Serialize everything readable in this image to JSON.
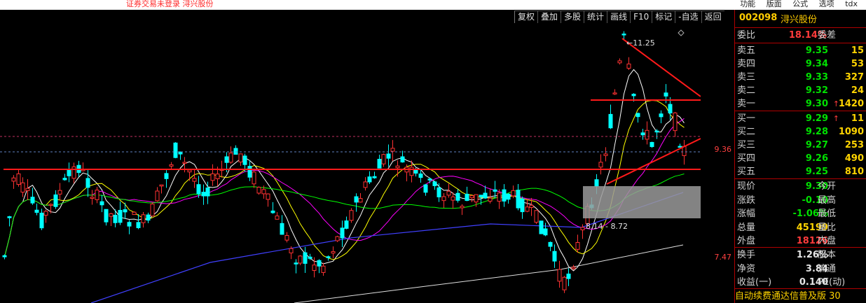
{
  "topbar": {
    "status_text": "证券交易未登录  浔兴股份",
    "menus": [
      "功能",
      "版面",
      "公式",
      "选项",
      "tdx"
    ]
  },
  "toolbar": [
    "复权",
    "叠加",
    "多股",
    "统计",
    "画线",
    "F10",
    "标记",
    "-自选",
    "返回"
  ],
  "chart_labels": {
    "high_label": "11.25",
    "range_label": "8.14 - 8.72",
    "axis_labels": [
      "9.36",
      "7.47"
    ]
  },
  "stock": {
    "code": "002098",
    "name": "浔兴股份",
    "weibi_label": "委比",
    "weibi_value": "18.14%",
    "weicha_label": "委差",
    "asks": [
      {
        "label": "卖五",
        "price": "9.35",
        "vol": "15",
        "arrow": ""
      },
      {
        "label": "卖四",
        "price": "9.34",
        "vol": "53",
        "arrow": ""
      },
      {
        "label": "卖三",
        "price": "9.33",
        "vol": "327",
        "arrow": ""
      },
      {
        "label": "卖二",
        "price": "9.32",
        "vol": "24",
        "arrow": ""
      },
      {
        "label": "卖一",
        "price": "9.30",
        "vol": "1420",
        "arrow": "↑"
      }
    ],
    "bids": [
      {
        "label": "买一",
        "price": "9.29",
        "vol": "11",
        "arrow": "↑"
      },
      {
        "label": "买二",
        "price": "9.28",
        "vol": "1090",
        "arrow": ""
      },
      {
        "label": "买三",
        "price": "9.27",
        "vol": "253",
        "arrow": ""
      },
      {
        "label": "买四",
        "price": "9.26",
        "vol": "490",
        "arrow": ""
      },
      {
        "label": "买五",
        "price": "9.25",
        "vol": "810",
        "arrow": ""
      }
    ],
    "stats": [
      {
        "label": "现价",
        "value": "9.30",
        "label2": "今开",
        "color": "green"
      },
      {
        "label": "涨跌",
        "value": "-0.10",
        "label2": "最高",
        "color": "green"
      },
      {
        "label": "涨幅",
        "value": "-1.06%",
        "label2": "最低",
        "color": "green"
      },
      {
        "label": "总量",
        "value": "45199",
        "label2": "量比",
        "color": "yellow"
      },
      {
        "label": "外盘",
        "value": "18126",
        "label2": "内盘",
        "color": "red"
      }
    ],
    "stats2": [
      {
        "label": "换手",
        "value": "1.26%",
        "label2": "股本"
      },
      {
        "label": "净资",
        "value": "3.84",
        "label2": "流通"
      },
      {
        "label": "收益(一)",
        "value": "0.140",
        "label2": "PE(动)"
      }
    ],
    "ticker": "自动续费通达信普及版  30"
  }
}
